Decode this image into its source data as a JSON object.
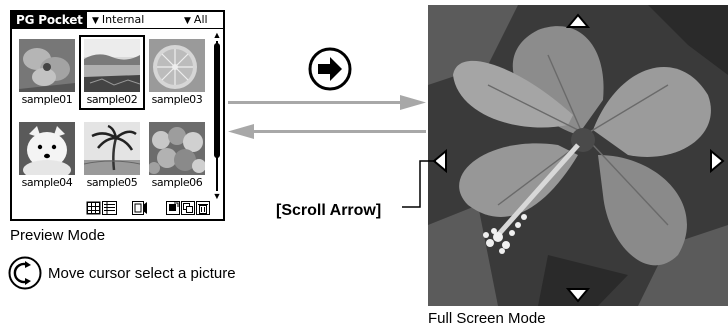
{
  "preview": {
    "app_title": "PG Pocket",
    "storage_dropdown": "Internal",
    "filter_dropdown": "All",
    "thumbnails": [
      {
        "label": "sample01",
        "icon": "flower-image"
      },
      {
        "label": "sample02",
        "icon": "lake-image",
        "selected": true
      },
      {
        "label": "sample03",
        "icon": "orange-slice-image"
      },
      {
        "label": "sample04",
        "icon": "dog-image"
      },
      {
        "label": "sample05",
        "icon": "palm-tree-image"
      },
      {
        "label": "sample06",
        "icon": "fruit-image"
      }
    ],
    "toolbar_icons": [
      "thumbnail-view-icon",
      "list-view-icon",
      "slideshow-icon",
      "copy-icon",
      "duplicate-icon",
      "trash-icon"
    ],
    "caption": "Preview Mode"
  },
  "hint": {
    "icon": "rotate-cursor-icon",
    "text": "Move cursor select a picture"
  },
  "fullscreen": {
    "caption": "Full Screen Mode",
    "scroll_label": "[Scroll Arrow]",
    "scroll_arrows": [
      "scroll-up-arrow",
      "scroll-left-arrow",
      "scroll-right-arrow",
      "scroll-down-arrow"
    ]
  },
  "colors": {
    "ink": "#000000",
    "paper": "#ffffff",
    "arrow_gray": "#a8a8a8",
    "photo_dark": "#3a3a3a",
    "petal": "#8c8c8c"
  }
}
